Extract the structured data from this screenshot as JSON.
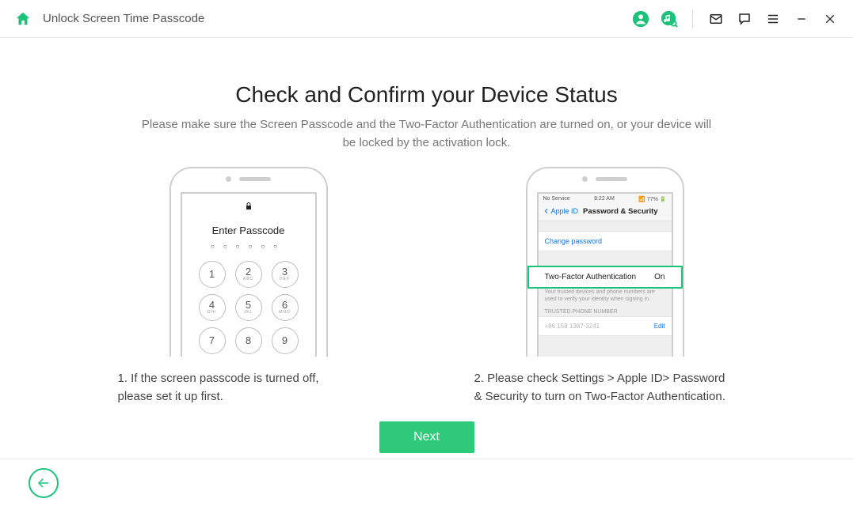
{
  "header": {
    "title": "Unlock Screen Time Passcode"
  },
  "main": {
    "title": "Check and Confirm your Device Status",
    "subtitle": "Please make sure the Screen Passcode and the Two-Factor Authentication are turned on, or your device will be locked by the activation lock."
  },
  "phone1": {
    "enter_label": "Enter Passcode",
    "keys": [
      "1",
      "2",
      "3",
      "4",
      "5",
      "6",
      "7",
      "8",
      "9"
    ],
    "subs": [
      "",
      "ABC",
      "DEF",
      "GHI",
      "JKL",
      "MNO",
      "",
      "",
      ""
    ]
  },
  "phone2": {
    "status_left": "No Service",
    "status_center": "8:22 AM",
    "status_right": "77%",
    "back_label": "Apple ID",
    "nav_title": "Password & Security",
    "change_password": "Change password",
    "tfa_label": "Two-Factor Authentication",
    "tfa_value": "On",
    "desc": "Your trusted devices and phone numbers are used to verify your identity when signing in.",
    "trusted_label": "TRUSTED PHONE NUMBER",
    "phone_number": "+86 158 1387-3241",
    "edit": "Edit"
  },
  "captions": {
    "c1": "1. If the screen passcode is turned off, please set it up first.",
    "c2": "2. Please check Settings > Apple ID> Password & Security to turn on Two-Factor Authentication."
  },
  "actions": {
    "next": "Next"
  }
}
